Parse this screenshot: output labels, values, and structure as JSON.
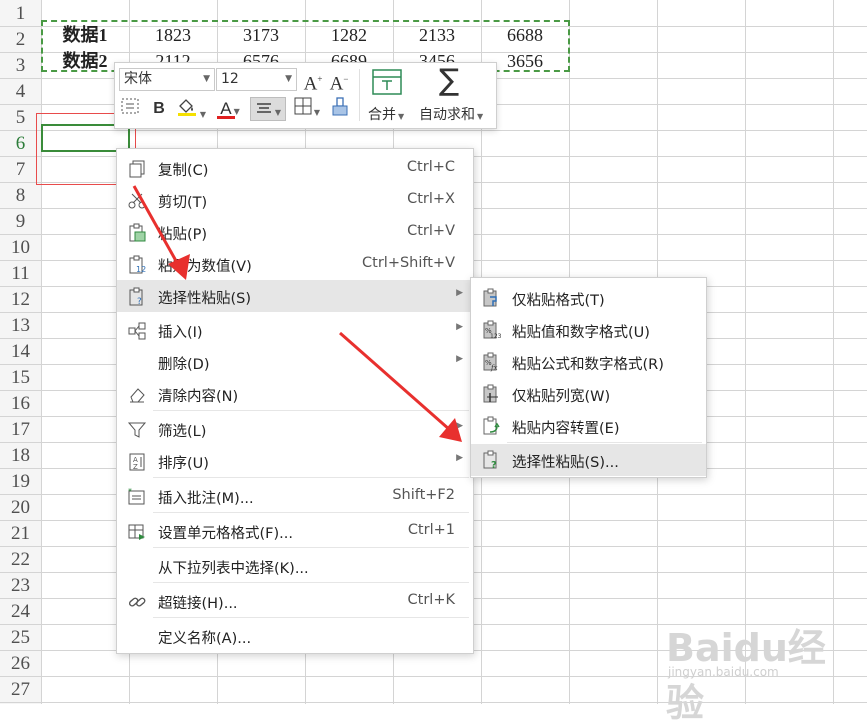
{
  "sheet": {
    "row_numbers": [
      "1",
      "2",
      "3",
      "4",
      "5",
      "6",
      "7",
      "8",
      "9",
      "10",
      "11",
      "12",
      "13",
      "14",
      "15",
      "16",
      "17",
      "18",
      "19",
      "20",
      "21",
      "22",
      "23",
      "24",
      "25",
      "26",
      "27"
    ],
    "active_row": "6",
    "rows": [
      {
        "label": "数据1",
        "values": [
          "1823",
          "3173",
          "1282",
          "2133",
          "6688"
        ]
      },
      {
        "label": "数据2",
        "values": [
          "2112",
          "6576",
          "6689",
          "3456",
          "3656"
        ]
      }
    ]
  },
  "toolbar": {
    "font_name": "宋体",
    "font_size": "12",
    "increase_font_label": "A+",
    "decrease_font_label": "A-",
    "bold_label": "B",
    "font_color_label": "A",
    "merge_label": "合并",
    "autosum_label": "自动求和",
    "font_color": "#e02020",
    "fill_color": "#f5e000"
  },
  "context_menu": {
    "items": [
      {
        "label": "复制(C)",
        "shortcut": "Ctrl+C",
        "icon": "copy-icon"
      },
      {
        "label": "剪切(T)",
        "shortcut": "Ctrl+X",
        "icon": "scissors-icon"
      },
      {
        "label": "粘贴(P)",
        "shortcut": "Ctrl+V",
        "icon": "paste-icon"
      },
      {
        "label": "粘贴为数值(V)",
        "shortcut": "Ctrl+Shift+V",
        "icon": "paste-values-icon"
      },
      {
        "label": "选择性粘贴(S)",
        "shortcut": "",
        "icon": "paste-special-icon",
        "has_submenu": true,
        "highlighted": true
      },
      {
        "label": "插入(I)",
        "shortcut": "",
        "icon": "insert-icon",
        "has_submenu": true
      },
      {
        "label": "删除(D)",
        "shortcut": "",
        "icon": "",
        "has_submenu": true
      },
      {
        "label": "清除内容(N)",
        "shortcut": "",
        "icon": "eraser-icon"
      },
      {
        "label": "筛选(L)",
        "shortcut": "",
        "icon": "filter-icon",
        "has_submenu": true
      },
      {
        "label": "排序(U)",
        "shortcut": "",
        "icon": "sort-icon",
        "has_submenu": true
      },
      {
        "label": "插入批注(M)...",
        "shortcut": "Shift+F2",
        "icon": "comment-icon"
      },
      {
        "label": "设置单元格格式(F)...",
        "shortcut": "Ctrl+1",
        "icon": "format-cells-icon"
      },
      {
        "label": "从下拉列表中选择(K)...",
        "shortcut": "",
        "icon": ""
      },
      {
        "label": "超链接(H)...",
        "shortcut": "Ctrl+K",
        "icon": "link-icon"
      },
      {
        "label": "定义名称(A)...",
        "shortcut": "",
        "icon": ""
      }
    ]
  },
  "submenu": {
    "items": [
      {
        "label": "仅粘贴格式(T)",
        "icon": "paste-format-icon"
      },
      {
        "label": "粘贴值和数字格式(U)",
        "icon": "paste-value-number-icon"
      },
      {
        "label": "粘贴公式和数字格式(R)",
        "icon": "paste-formula-icon"
      },
      {
        "label": "仅粘贴列宽(W)",
        "icon": "paste-column-width-icon"
      },
      {
        "label": "粘贴内容转置(E)",
        "icon": "paste-transpose-icon"
      },
      {
        "label": "选择性粘贴(S)...",
        "icon": "paste-special-dialog-icon",
        "highlighted": true
      }
    ]
  },
  "watermark": {
    "logo": "Baidu经验",
    "url": "jingyan.baidu.com"
  },
  "colors": {
    "arrow": "#e8302e",
    "grid": "#d4d4d4",
    "selection_green": "#3a8c3a"
  }
}
